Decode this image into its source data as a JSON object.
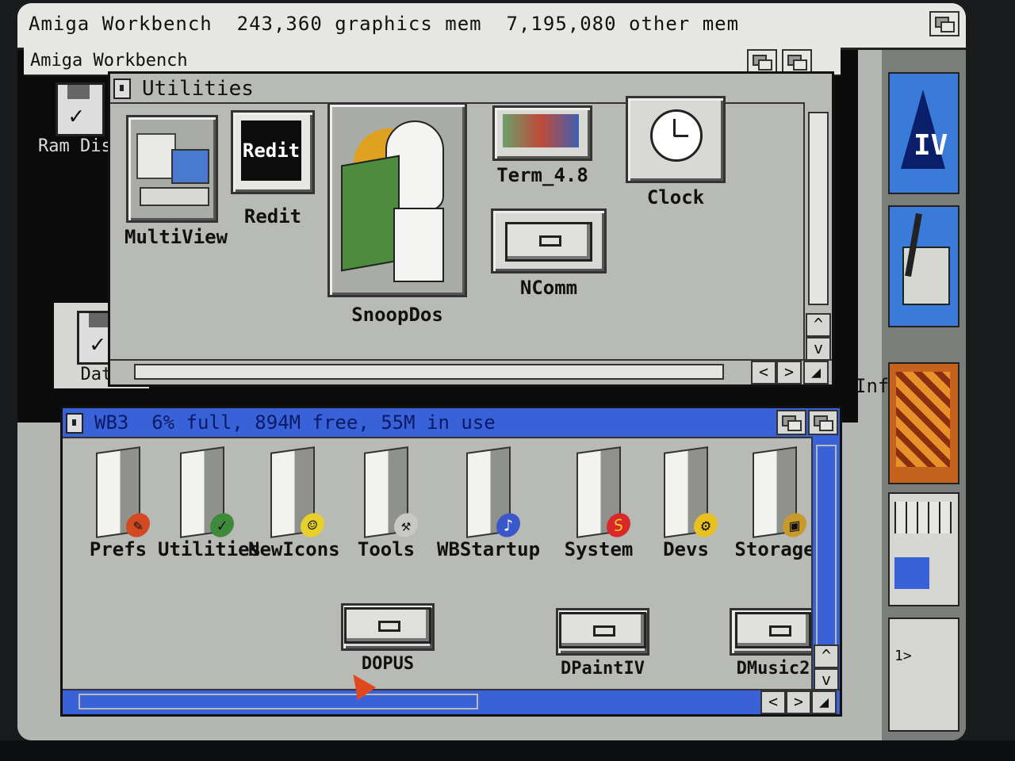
{
  "screen": {
    "title": "Amiga Workbench  243,360 graphics mem  7,195,080 other mem"
  },
  "desktop_icons": [
    {
      "label": "Ram Disk",
      "icon": "ram-disk-icon"
    },
    {
      "label": "Data",
      "icon": "hard-disk-icon"
    }
  ],
  "utilities_window": {
    "title": "Utilities",
    "icons": [
      {
        "label": "MultiView",
        "icon": "multiview-icon"
      },
      {
        "label": "Redit",
        "icon": "redit-icon",
        "glyph_text": "Redit"
      },
      {
        "label": "SnoopDos",
        "icon": "snoopdos-icon"
      },
      {
        "label": "Term_4.8",
        "icon": "terminal-icon"
      },
      {
        "label": "Clock",
        "icon": "clock-icon"
      },
      {
        "label": "NComm",
        "icon": "drawer-icon"
      }
    ]
  },
  "wb3_window": {
    "title": "WB3  6% full, 894M free, 55M in use",
    "drawers": [
      {
        "label": "Prefs",
        "badge": "prefs-badge"
      },
      {
        "label": "Utilities",
        "badge": "utilities-badge"
      },
      {
        "label": "NewIcons",
        "badge": "smiley-badge"
      },
      {
        "label": "Tools",
        "badge": "hammer-badge"
      },
      {
        "label": "WBStartup",
        "badge": "startup-badge"
      },
      {
        "label": "System",
        "badge": "superman-badge"
      },
      {
        "label": "Devs",
        "badge": "gear-badge"
      },
      {
        "label": "Storage",
        "badge": "box-badge"
      }
    ],
    "folders": [
      {
        "label": "DOPUS"
      },
      {
        "label": "DPaintIV"
      },
      {
        "label": "DMusic2"
      }
    ]
  },
  "right_strip": {
    "partial_label": "Inf",
    "shell_prompt": "1>"
  },
  "colors": {
    "window_gray": "#b8bab5",
    "active_blue": "#3a62d8",
    "title_text": "#111111"
  }
}
